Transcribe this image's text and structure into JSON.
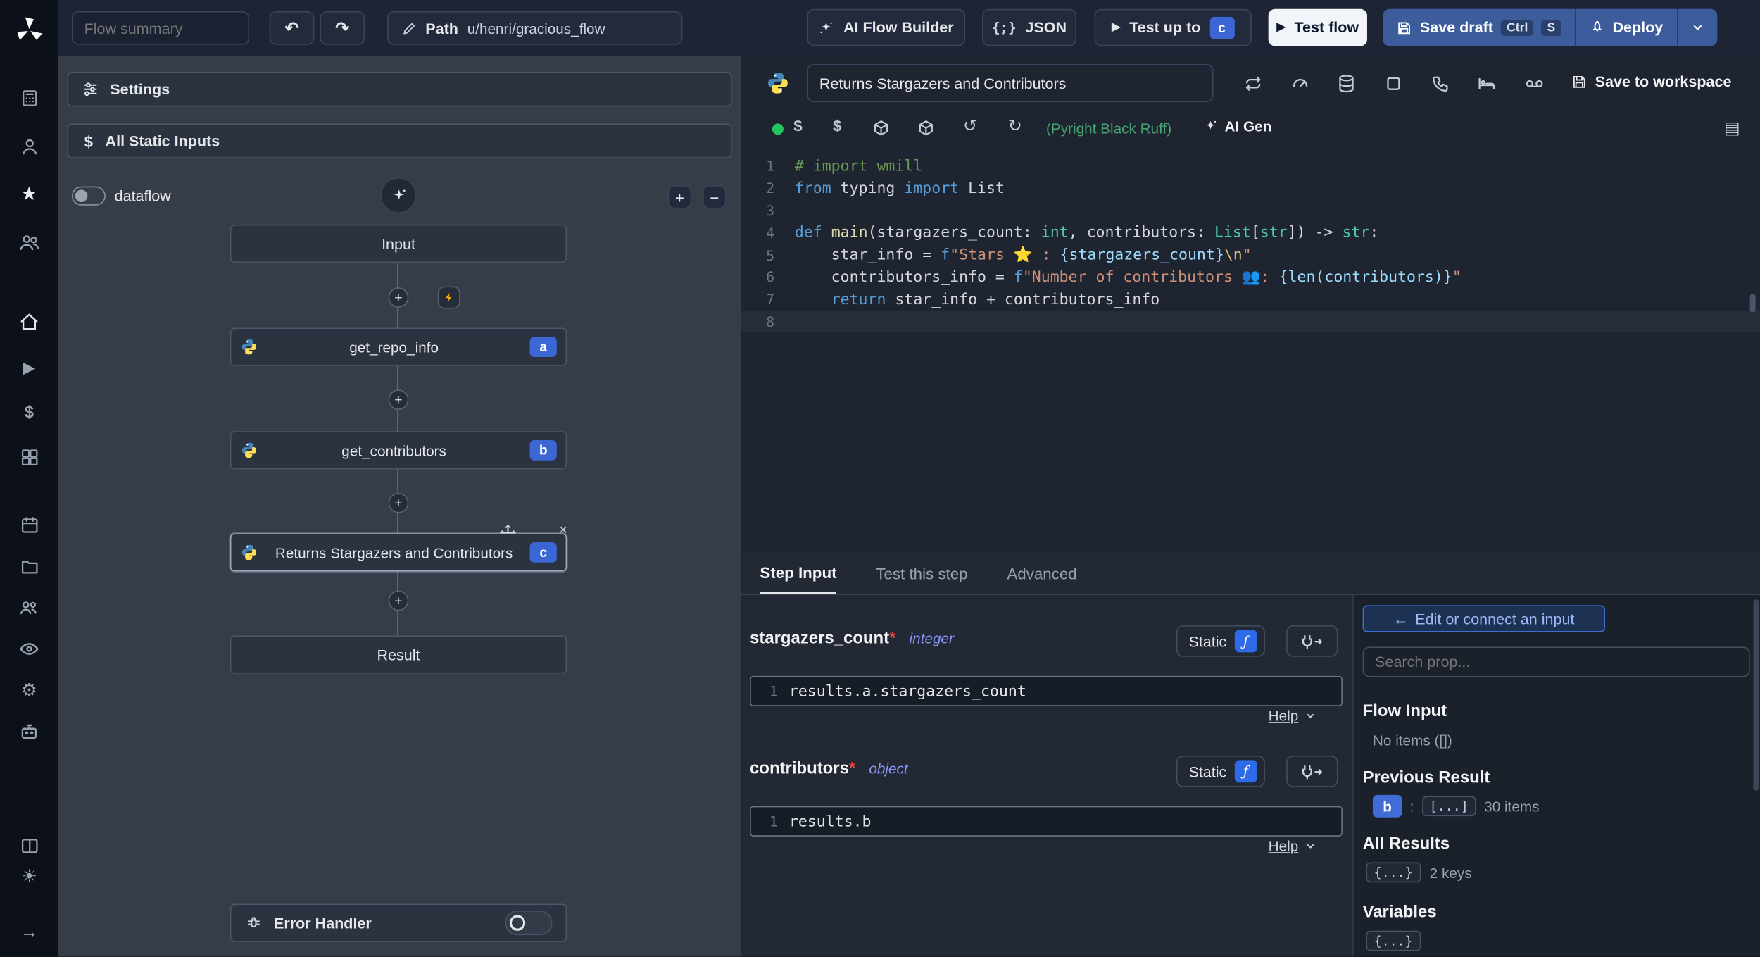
{
  "topbar": {
    "flow_summary_placeholder": "Flow summary",
    "path_label": "Path",
    "path_value": "u/henri/gracious_flow",
    "ai_flow_builder_label": "AI Flow Builder",
    "json_label": "JSON",
    "test_up_to_label": "Test up to",
    "test_up_to_badge": "c",
    "test_flow_label": "Test flow",
    "save_draft_label": "Save draft",
    "save_draft_kbd_1": "Ctrl",
    "save_draft_kbd_2": "S",
    "deploy_label": "Deploy"
  },
  "flow_panel": {
    "settings_label": "Settings",
    "static_inputs_label": "All Static Inputs",
    "dataflow_label": "dataflow",
    "input_label": "Input",
    "result_label": "Result",
    "error_handler_label": "Error Handler",
    "steps": [
      {
        "label": "get_repo_info",
        "badge": "a"
      },
      {
        "label": "get_contributors",
        "badge": "b"
      },
      {
        "label": "Returns Stargazers and Contributors",
        "badge": "c"
      }
    ]
  },
  "editor": {
    "title": "Returns Stargazers and Contributors",
    "save_to_workspace_label": "Save to workspace",
    "assistants_label": "(Pyright Black Ruff)",
    "ai_gen_label": "AI Gen",
    "language": "python",
    "code_lines": [
      [
        {
          "t": "# import wmill",
          "c": "cm"
        }
      ],
      [
        {
          "t": "from",
          "c": "kw"
        },
        {
          "t": " typing ",
          "c": "pl"
        },
        {
          "t": "import",
          "c": "kw"
        },
        {
          "t": " List",
          "c": "pl"
        }
      ],
      [],
      [
        {
          "t": "def",
          "c": "kw"
        },
        {
          "t": " ",
          "c": "pl"
        },
        {
          "t": "main",
          "c": "fn"
        },
        {
          "t": "(stargazers_count: ",
          "c": "pl"
        },
        {
          "t": "int",
          "c": "ty"
        },
        {
          "t": ", contributors: ",
          "c": "pl"
        },
        {
          "t": "List",
          "c": "ty"
        },
        {
          "t": "[",
          "c": "pl"
        },
        {
          "t": "str",
          "c": "ty"
        },
        {
          "t": "]) -> ",
          "c": "pl"
        },
        {
          "t": "str",
          "c": "ty"
        },
        {
          "t": ":",
          "c": "pl"
        }
      ],
      [
        {
          "t": "    star_info = ",
          "c": "pl"
        },
        {
          "t": "f",
          "c": "kw"
        },
        {
          "t": "\"Stars ⭐ : ",
          "c": "str"
        },
        {
          "t": "{stargazers_count}",
          "c": "interp"
        },
        {
          "t": "\\n",
          "c": "esc"
        },
        {
          "t": "\"",
          "c": "str"
        }
      ],
      [
        {
          "t": "    contributors_info = ",
          "c": "pl"
        },
        {
          "t": "f",
          "c": "kw"
        },
        {
          "t": "\"Number of contributors 👥: ",
          "c": "str"
        },
        {
          "t": "{len(contributors)}",
          "c": "interp"
        },
        {
          "t": "\"",
          "c": "str"
        }
      ],
      [
        {
          "t": "    ",
          "c": "pl"
        },
        {
          "t": "return",
          "c": "kw"
        },
        {
          "t": " star_info + contributors_info",
          "c": "pl"
        }
      ],
      []
    ]
  },
  "tabs": [
    {
      "label": "Step Input"
    },
    {
      "label": "Test this step"
    },
    {
      "label": "Advanced"
    }
  ],
  "step_input": {
    "fields": [
      {
        "name": "stargazers_count",
        "required": "*",
        "type": "integer",
        "mode": "Static",
        "line_no": "1",
        "expr": "results.a.stargazers_count",
        "help": "Help"
      },
      {
        "name": "contributors",
        "required": "*",
        "type": "object",
        "mode": "Static",
        "line_no": "1",
        "expr": "results.b",
        "help": "Help"
      }
    ]
  },
  "props": {
    "edit_connect_label": "Edit or connect an input",
    "search_placeholder": "Search prop...",
    "flow_input_title": "Flow Input",
    "flow_input_empty": "No items ([])",
    "previous_result_title": "Previous Result",
    "previous_result_badge": "b",
    "previous_result_chip": "[...]",
    "previous_result_count": "30 items",
    "all_results_title": "All Results",
    "all_results_chip": "{...}",
    "all_results_count": "2 keys",
    "variables_title": "Variables",
    "variables_chip": "{...}"
  },
  "colors": {
    "accent_blue": "#3b66d3",
    "save_blue": "#3c5c9c",
    "green_dot": "#22c55e",
    "selected_node_border": "#9aa7bd"
  },
  "icon_names": {
    "sidebar": [
      "windmill-logo",
      "grid-icon",
      "user-icon",
      "star-icon",
      "users-icon",
      "home-icon",
      "play-icon",
      "dollar-icon",
      "blocks-icon",
      "calendar-icon",
      "folder-icon",
      "group-icon",
      "eye-icon",
      "gear-icon",
      "worker-icon",
      "panels-icon",
      "sun-icon",
      "arrow-right-icon"
    ],
    "editor_header": [
      "arrows-cycle-icon",
      "gauge-icon",
      "database-icon",
      "square-icon",
      "phone-icon",
      "bed-icon",
      "voicemail-icon"
    ]
  }
}
